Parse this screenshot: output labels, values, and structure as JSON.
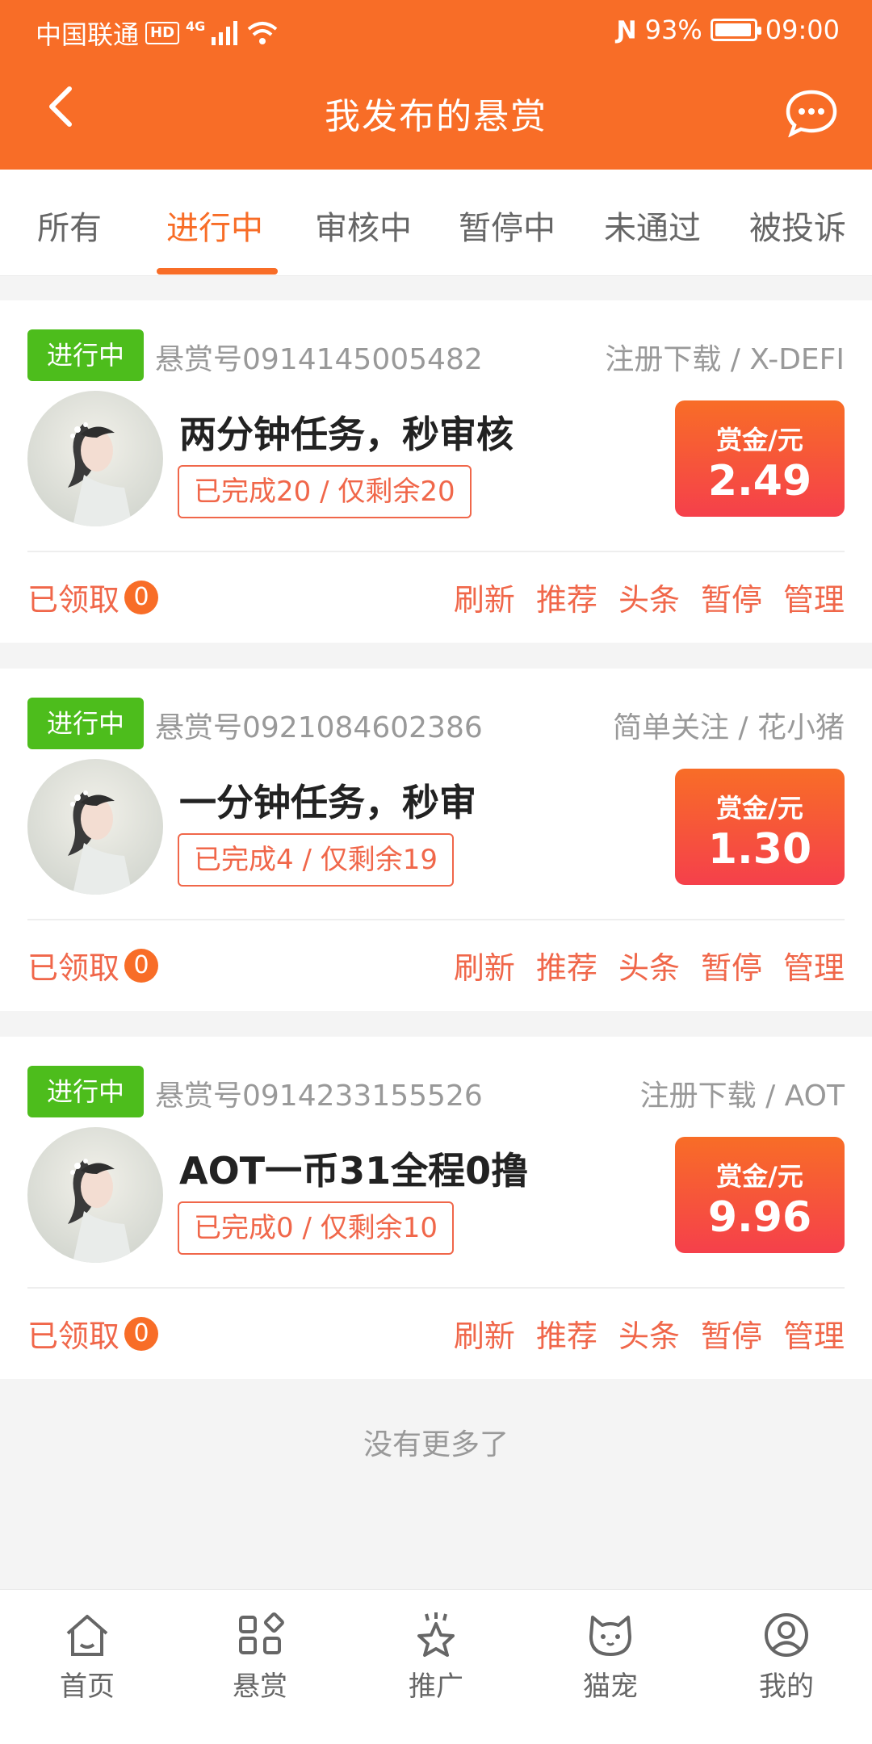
{
  "status_bar": {
    "carrier": "中国联通",
    "hd": "HD",
    "network": "4G",
    "battery": "93%",
    "time": "09:00"
  },
  "header": {
    "title": "我发布的悬赏"
  },
  "tabs": [
    {
      "label": "所有"
    },
    {
      "label": "进行中",
      "active": true
    },
    {
      "label": "审核中"
    },
    {
      "label": "暂停中"
    },
    {
      "label": "未通过"
    },
    {
      "label": "被投诉"
    }
  ],
  "cards": [
    {
      "status": "进行中",
      "task_no": "悬赏号0914145005482",
      "category": "注册下载 / X-DEFI",
      "title": "两分钟任务，秒审核",
      "progress": "已完成20 / 仅剩余20",
      "reward_label": "赏金/元",
      "reward_amount": "2.49",
      "claimed_label": "已领取",
      "claimed_count": "0",
      "actions": [
        "刷新",
        "推荐",
        "头条",
        "暂停",
        "管理"
      ]
    },
    {
      "status": "进行中",
      "task_no": "悬赏号0921084602386",
      "category": "简单关注 / 花小猪",
      "title": "一分钟任务，秒审",
      "progress": "已完成4 / 仅剩余19",
      "reward_label": "赏金/元",
      "reward_amount": "1.30",
      "claimed_label": "已领取",
      "claimed_count": "0",
      "actions": [
        "刷新",
        "推荐",
        "头条",
        "暂停",
        "管理"
      ]
    },
    {
      "status": "进行中",
      "task_no": "悬赏号0914233155526",
      "category": "注册下载 / AOT",
      "title": "AOT一币31全程0撸",
      "progress": "已完成0 / 仅剩余10",
      "reward_label": "赏金/元",
      "reward_amount": "9.96",
      "claimed_label": "已领取",
      "claimed_count": "0",
      "actions": [
        "刷新",
        "推荐",
        "头条",
        "暂停",
        "管理"
      ]
    }
  ],
  "footer_text": "没有更多了",
  "bottom_nav": [
    {
      "label": "首页",
      "icon": "home-icon"
    },
    {
      "label": "悬赏",
      "icon": "grid-icon"
    },
    {
      "label": "推广",
      "icon": "star-icon"
    },
    {
      "label": "猫宠",
      "icon": "cat-icon"
    },
    {
      "label": "我的",
      "icon": "user-icon"
    }
  ],
  "colors": {
    "brand": "#f86d27",
    "status_green": "#4dbd1c",
    "accent_red": "#f0674a"
  }
}
